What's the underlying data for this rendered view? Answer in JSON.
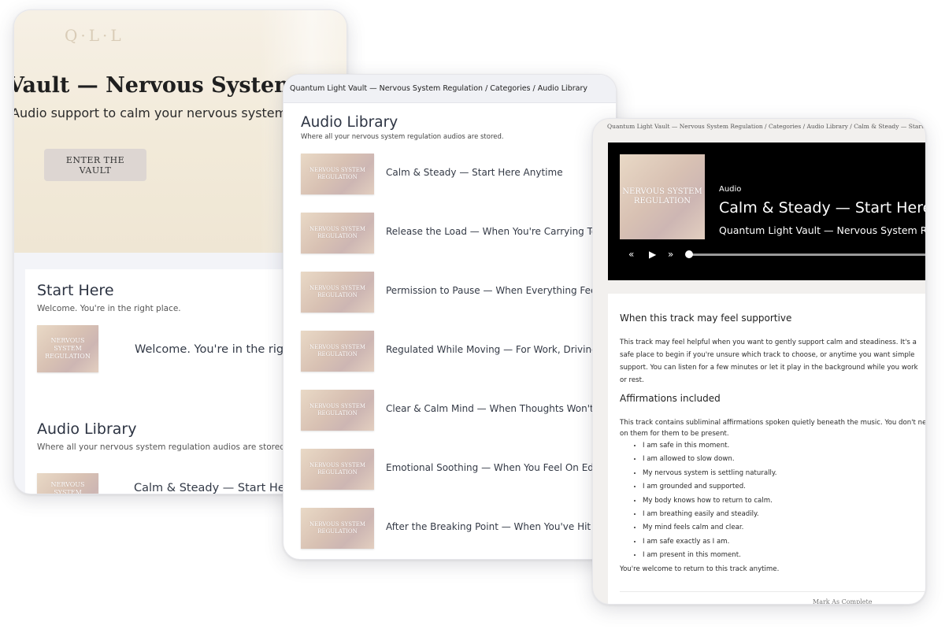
{
  "card1": {
    "logo": "Q·L·L",
    "hero_title": "Vault — Nervous System Regulation",
    "hero_subtitle": "Audio support to calm your nervous system.",
    "enter_button": "ENTER THE VAULT",
    "start_here": {
      "title": "Start Here",
      "subtitle": "Welcome. You're in the right place.",
      "item_label": "Welcome. You're in the right place.",
      "thumb_line1": "NERVOUS SYSTEM",
      "thumb_line2": "REGULATION"
    },
    "audio_library": {
      "title": "Audio Library",
      "subtitle": "Where all your nervous system regulation audios are stored.",
      "item_label": "Calm & Steady — Start Here Anytime",
      "thumb_line1": "NERVOUS SYSTEM"
    }
  },
  "card2": {
    "breadcrumb": "Quantum Light Vault — Nervous System Regulation / Categories / Audio Library",
    "title": "Audio Library",
    "subtitle": "Where all your nervous system regulation audios are stored.",
    "thumb_line1": "NERVOUS SYSTEM",
    "thumb_line2": "REGULATION",
    "items": [
      {
        "label": "Calm & Steady — Start Here Anytime"
      },
      {
        "label": "Release the Load — When You're Carrying Too Much"
      },
      {
        "label": "Permission to Pause — When Everything Feels Urgent"
      },
      {
        "label": "Regulated While Moving — For Work, Driving, or Errands"
      },
      {
        "label": "Clear & Calm Mind — When Thoughts Won't Slow Down"
      },
      {
        "label": "Emotional Soothing — When You Feel On Edge"
      },
      {
        "label": "After the Breaking Point — When You've Hit Your Limit"
      }
    ]
  },
  "card3": {
    "breadcrumb": "Quantum Light Vault — Nervous System Regulation / Categories / Audio Library / Calm & Steady — Start Here Anytime",
    "player": {
      "thumb_line1": "NERVOUS SYSTEM",
      "thumb_line2": "REGULATION",
      "kind": "Audio",
      "title": "Calm & Steady — Start Here Anytime",
      "artist": "Quantum Light Vault — Nervous System Regulation",
      "rewind_icon": "«",
      "play_icon": "▶",
      "forward_icon": "»",
      "progress": 0
    },
    "supportive_heading": "When this track may feel supportive",
    "supportive_lines": [
      "This track may feel helpful when you want to gently support calm and steadiness. It's a",
      "safe place to begin if you're unsure which track to choose, or anytime you want simple",
      "support. You can listen for a few minutes or let it play in the background while you work",
      "or rest."
    ],
    "affirmations_heading": "Affirmations included",
    "affirmations_intro_lines": [
      "This track contains subliminal affirmations spoken quietly beneath the music. You don't need to focus",
      "on them for them to be present."
    ],
    "affirmations": [
      "I am safe in this moment.",
      "I am allowed to slow down.",
      "My nervous system is settling naturally.",
      "I am grounded and supported.",
      "My body knows how to return to calm.",
      "I am breathing easily and steadily.",
      "My mind feels calm and clear.",
      "I am safe exactly as I am.",
      "I am present in this moment."
    ],
    "closing": "You're welcome to return to this track anytime.",
    "mark_complete": "Mark As Complete"
  }
}
